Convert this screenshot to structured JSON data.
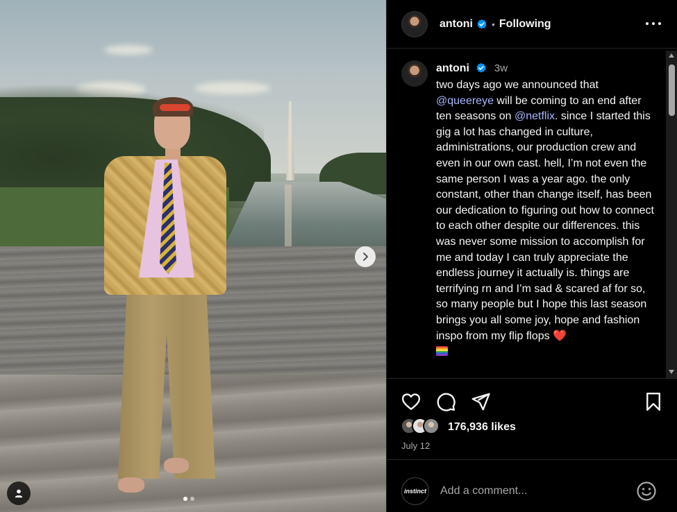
{
  "post": {
    "username": "antoni",
    "separator": "•",
    "follow_status": "Following",
    "time_ago": "3w",
    "caption_parts": {
      "p1": "two days ago we announced that ",
      "mention1": "@queereye",
      "p2": " will be coming to an end after ten seasons on ",
      "mention2": "@netflix",
      "p3": ". since I started this gig a lot has changed in culture, administrations, our production crew and even in our own cast. hell, I’m not even the same person I was a year ago. the only constant, other than change itself, has been our dedication to figuring out how to connect to each other despite our differences. this was never some mission to accomplish for me and today I can truly appreciate the endless journey it actually is. things are terrifying rn and I’m sad & scared af for so, so many people but I hope this last season brings you all some joy, hope and fashion inspo from my flip flops ",
      "heart": "❤️"
    },
    "likes": "176,936 likes",
    "date": "July 12"
  },
  "comment_box": {
    "placeholder": "Add a comment...",
    "commenter_avatar_text": "instinct"
  },
  "carousel": {
    "dot_count": 2,
    "active_index": 0
  },
  "colors": {
    "background": "#000000",
    "mention": "#a7b6ff",
    "verified": "#0095f6",
    "muted": "#a8a8a8"
  }
}
